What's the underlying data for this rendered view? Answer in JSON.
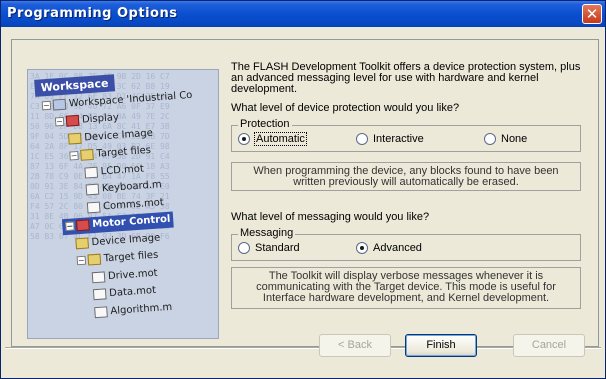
{
  "window": {
    "title": "Programming Options",
    "close_glyph": "✕"
  },
  "side_image": {
    "workspace_label": "Workspace",
    "tree": [
      {
        "label": "Workspace 'Industrial Co",
        "kind": "workspace",
        "icon": "workspace-icon"
      },
      {
        "label": "Display",
        "kind": "project",
        "icon": "project-icon"
      },
      {
        "label": "Device Image",
        "kind": "folder",
        "icon": "folder-icon"
      },
      {
        "label": "Target files",
        "kind": "folder",
        "icon": "folder-icon"
      },
      {
        "label": "LCD.mot",
        "kind": "file",
        "icon": "file-icon"
      },
      {
        "label": "Keyboard.m",
        "kind": "file",
        "icon": "file-icon"
      },
      {
        "label": "Comms.mot",
        "kind": "file",
        "icon": "file-icon"
      },
      {
        "label": "Motor Control",
        "kind": "project-selected",
        "icon": "project-icon"
      },
      {
        "label": "Device Image",
        "kind": "folder",
        "icon": "folder-icon"
      },
      {
        "label": "Target files",
        "kind": "folder",
        "icon": "folder-icon"
      },
      {
        "label": "Drive.mot",
        "kind": "file",
        "icon": "file-icon"
      },
      {
        "label": "Data.mot",
        "kind": "file",
        "icon": "file-icon"
      },
      {
        "label": "Algorithm.m",
        "kind": "file",
        "icon": "file-icon"
      }
    ]
  },
  "intro_text": "The FLASH Development Toolkit offers a device protection system, plus an advanced messaging level for use with hardware and kernel development.",
  "protection": {
    "question": "What level of device protection would you like?",
    "legend": "Protection",
    "options": [
      "Automatic",
      "Interactive",
      "None"
    ],
    "selected": "Automatic",
    "description": "When programming the device, any blocks found to have been written previously will automatically be erased."
  },
  "messaging": {
    "question": "What level of messaging would you like?",
    "legend": "Messaging",
    "options": [
      "Standard",
      "Advanced"
    ],
    "selected": "Advanced",
    "description": "The Toolkit will display verbose messages whenever it is communicating with the Target device. This mode is useful for Interface hardware development, and Kernel development."
  },
  "buttons": {
    "back": "< Back",
    "finish": "Finish",
    "cancel": "Cancel"
  },
  "colors": {
    "titlebar": "#0a4fcf",
    "dialog_bg": "#ece9d8",
    "close_button": "#c6381a"
  }
}
